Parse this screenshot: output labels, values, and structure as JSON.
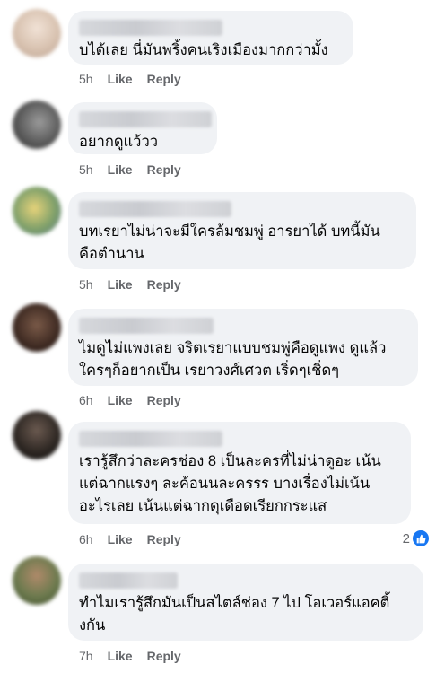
{
  "comments": [
    {
      "text": "บได้เลย นี่มันพริ้งคนเริงเมืองมากกว่ามั้ง",
      "time": "5h",
      "like": "Like",
      "reply": "Reply"
    },
    {
      "text": "อยากดูแว้วว",
      "time": "5h",
      "like": "Like",
      "reply": "Reply"
    },
    {
      "text": "บทเรยาไม่น่าจะมีใครล้มชมพู่ อารยาได้ บทนี้มัน\nคือตำนาน",
      "time": "5h",
      "like": "Like",
      "reply": "Reply"
    },
    {
      "text": "ไมดูไม่แพงเลย จริตเรยาแบบชมพู่คือดูแพง ดูแล้ว\nใครๆก็อยากเป็น เรยาวงศ์เศวต เริ่ดๆเชิ่ดๆ",
      "time": "6h",
      "like": "Like",
      "reply": "Reply"
    },
    {
      "text": "เรารู้สึกว่าละครช่อง 8 เป็นละครที่ไม่น่าดูอะ เน้น\nแต่ฉากแรงๆ ละค้อนนละครรร บางเรื่องไม่เน้น\nอะไรเลย เน้นแต่ฉากดุเดือดเรียกกระแส",
      "time": "6h",
      "like": "Like",
      "reply": "Reply",
      "reaction_count": "2"
    },
    {
      "text": "ทำไมเรารู้สึกมันเป็นสไตล์ช่อง 7 ไป โอเวอร์แอคติ้\nงกัน",
      "time": "7h",
      "like": "Like",
      "reply": "Reply"
    }
  ],
  "colors": {
    "bubble": "#f0f2f5",
    "meta": "#65676b",
    "like_badge": "#1877f2"
  },
  "icons": {
    "reaction": "thumbs-up-icon"
  }
}
